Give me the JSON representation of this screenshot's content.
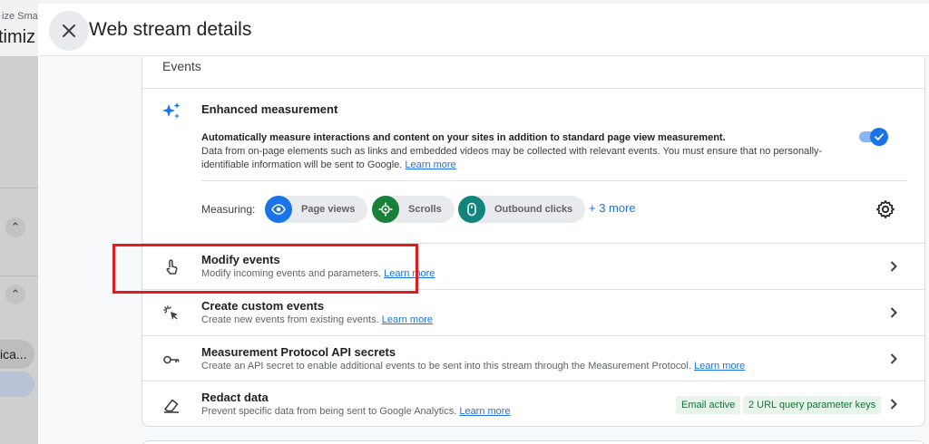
{
  "backdrop": {
    "text1": "ize Sma",
    "text2": "timiz",
    "pill": "ica..."
  },
  "header": {
    "title": "Web stream details",
    "close_icon": "close-icon"
  },
  "events_card": {
    "title": "Events",
    "enhanced": {
      "title": "Enhanced measurement",
      "desc_bold": "Automatically measure interactions and content on your sites in addition to standard page view measurement.",
      "desc_text": "Data from on-page elements such as links and embedded videos may be collected with relevant events. You must ensure that no personally-identifiable information will be sent to Google.",
      "learn_more": "Learn more",
      "toggle_on": true
    },
    "measuring": {
      "label": "Measuring:",
      "chips": [
        {
          "label": "Page views",
          "icon": "eye-icon",
          "color": "#1a73e8"
        },
        {
          "label": "Scrolls",
          "icon": "scroll-target-icon",
          "color": "#188038"
        },
        {
          "label": "Outbound clicks",
          "icon": "mouse-icon",
          "color": "#12847e"
        }
      ],
      "more": "+ 3 more"
    },
    "rows": [
      {
        "title": "Modify events",
        "desc": "Modify incoming events and parameters.",
        "link": "Learn more",
        "icon": "touch-icon"
      },
      {
        "title": "Create custom events",
        "desc": "Create new events from existing events.",
        "link": "Learn more",
        "icon": "sparkle-click-icon"
      },
      {
        "title": "Measurement Protocol API secrets",
        "desc": "Create an API secret to enable additional events to be sent into this stream through the Measurement Protocol.",
        "link": "Learn more",
        "icon": "key-icon"
      },
      {
        "title": "Redact data",
        "desc": "Prevent specific data from being sent to Google Analytics.",
        "link": "Learn more",
        "icon": "eraser-icon",
        "badges": [
          "Email active",
          "2 URL query parameter keys"
        ]
      }
    ]
  },
  "colors": {
    "accent": "#1a73e8",
    "highlight": "#e41a1c",
    "badge_bg": "#e6f4ea",
    "badge_text": "#137333"
  }
}
